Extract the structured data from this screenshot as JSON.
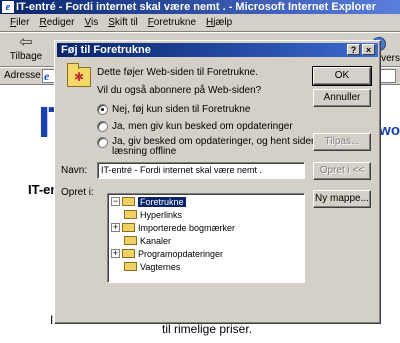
{
  "window": {
    "title": "IT-entré - Fordi internet skal være nemt . - Microsoft Internet Explorer"
  },
  "menu": [
    "Filer",
    "Rediger",
    "Vis",
    "Skift til",
    "Foretrukne",
    "Hjælp"
  ],
  "toolbar": {
    "back_label": "Tilbage",
    "right_label": "Overs"
  },
  "address": {
    "label": "Adresse"
  },
  "page": {
    "logo": "IT",
    "ws_text": "s wo",
    "heading": "IT-en",
    "left_fragment": "I",
    "footer": "til rimelige priser."
  },
  "dialog": {
    "title": "Føj til Foretrukne",
    "help": "?",
    "close": "×",
    "intro": "Dette føjer Web-siden til Foretrukne.",
    "question": "Vil du også abonnere på Web-siden?",
    "options": [
      {
        "label": "Nej, føj kun siden til Foretrukne",
        "checked": true
      },
      {
        "label": "Ja, men giv kun besked om opdateringer",
        "checked": false
      },
      {
        "label1": "Ja, giv besked om opdateringer, og hent siden til",
        "label2": "læsning offline",
        "checked": false
      }
    ],
    "ok": "OK",
    "cancel": "Annuller",
    "customize": "Tilpas...",
    "name_label": "Navn:",
    "name_value": "IT-entré - Fordi internet skal være nemt .",
    "create_in": "Opret i <<",
    "create_label": "Opret i:",
    "new_folder": "Ny mappe...",
    "tree": [
      {
        "label": "Foretrukne",
        "expander": "−",
        "selected": true
      },
      {
        "label": "Hyperlinks",
        "expander": "",
        "selected": false
      },
      {
        "label": "Importerede bogmærker",
        "expander": "+",
        "selected": false
      },
      {
        "label": "Kanaler",
        "expander": "",
        "selected": false
      },
      {
        "label": "Programopdateringer",
        "expander": "+",
        "selected": false
      },
      {
        "label": "Vagternes",
        "expander": "",
        "selected": false
      }
    ]
  }
}
